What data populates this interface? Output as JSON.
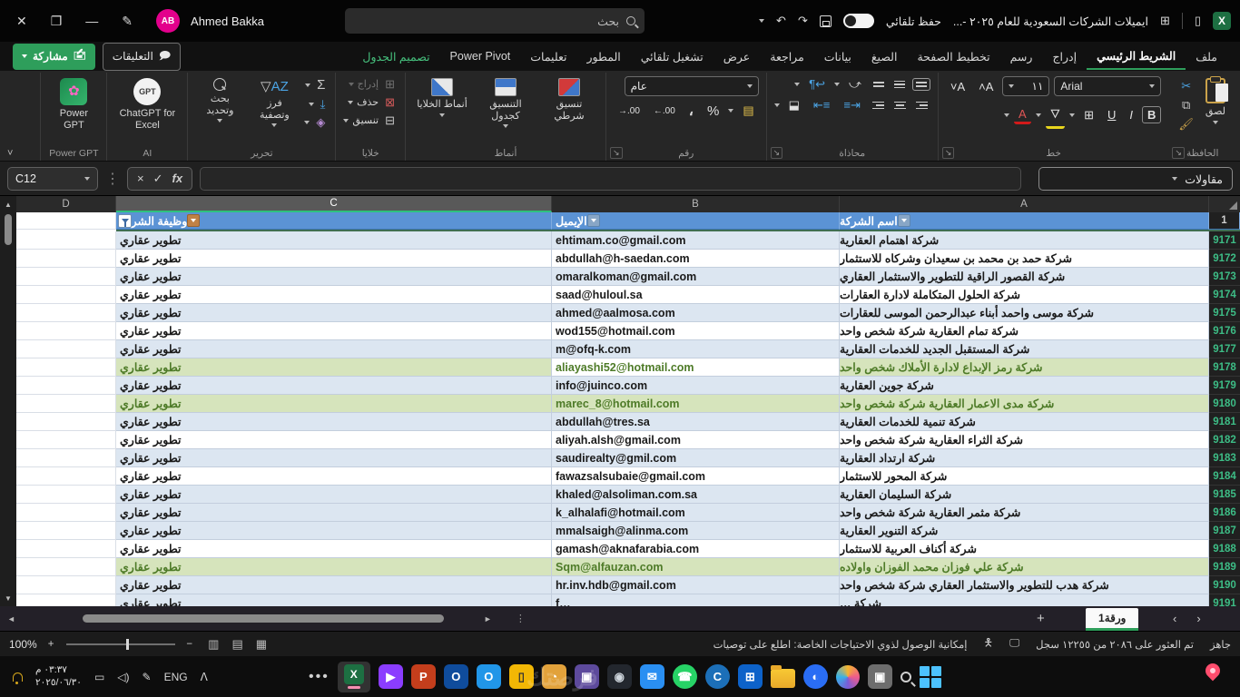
{
  "colors": {
    "excel_green": "#1d6f42",
    "accent_green": "#2e9e5b",
    "band_blue": "#dce6f1",
    "band_green": "#d6e4bc",
    "header_blue": "#5b93d5",
    "avatar_pink": "#e3008c"
  },
  "titlebar": {
    "user_initials": "AB",
    "user_name": "Ahmed Bakka",
    "search_placeholder": "بحث",
    "file_name": "ايميلات الشركات السعودية للعام ٢٠٢٥ -...",
    "autosave_label": "حفظ تلقائي"
  },
  "ribbon_tabs": {
    "items": [
      {
        "label": "ملف"
      },
      {
        "label": "الشريط الرئيسي",
        "active": true
      },
      {
        "label": "إدراج"
      },
      {
        "label": "رسم"
      },
      {
        "label": "تخطيط الصفحة"
      },
      {
        "label": "الصيغ"
      },
      {
        "label": "بيانات"
      },
      {
        "label": "مراجعة"
      },
      {
        "label": "عرض"
      },
      {
        "label": "تشغيل تلقائي"
      },
      {
        "label": "المطور"
      },
      {
        "label": "تعليمات"
      },
      {
        "label": "Power Pivot"
      },
      {
        "label": "تصميم الجدول",
        "accent": true
      }
    ],
    "comments_label": "التعليقات",
    "share_label": "مشاركة"
  },
  "ribbon": {
    "clipboard": {
      "label": "الحافظة",
      "paste": "لصق"
    },
    "font": {
      "label": "خط",
      "font_name": "Arial",
      "font_size": "١١",
      "bold": "B",
      "italic": "I",
      "underline": "U"
    },
    "alignment": {
      "label": "محاذاة"
    },
    "number": {
      "label": "رقم",
      "format": "عام",
      "percent": "%",
      "comma": "،"
    },
    "styles": {
      "label": "أنماط",
      "conditional": "تنسيق شرطي",
      "format_table": "التنسيق كجدول",
      "cell_styles": "أنماط الخلايا"
    },
    "cells": {
      "label": "خلايا",
      "insert": "إدراج",
      "delete": "حذف",
      "format": "تنسيق"
    },
    "editing": {
      "label": "تحرير",
      "autosum": "Σ",
      "sort_filter": "فرز وتصفية",
      "find_select": "بحث وتحديد"
    },
    "ai": {
      "label": "AI",
      "chatgpt": "ChatGPT for Excel",
      "icon_text": "GPT"
    },
    "powergpt": {
      "label": "Power GPT",
      "button": "Power GPT"
    }
  },
  "formula_bar": {
    "name_box": "C12",
    "fx": "fx",
    "cancel": "×",
    "enter": "✓",
    "value": "",
    "range_dropdown": "مقاولات"
  },
  "grid": {
    "column_letters": [
      "D",
      "C",
      "B",
      "A"
    ],
    "header_row_number": "1",
    "headers": {
      "job": "وظيفة الشركة",
      "email": "الإيميل",
      "name": "اسم الشركة"
    },
    "rows": [
      {
        "n": "9171",
        "name": "شركة اهتمام العقارية",
        "email": "ehtimam.co@gmail.com",
        "job": "تطوير عقاري",
        "band": "blue"
      },
      {
        "n": "9172",
        "name": "شركة حمد بن محمد بن سعيدان وشركاه للاستثمار",
        "email": "abdullah@h-saedan.com",
        "job": "تطوير عقاري",
        "band": "white"
      },
      {
        "n": "9173",
        "name": "شركة القصور الراقية للتطوير والاستثمار العقاري",
        "email": "omaralkoman@gmail.com",
        "job": "تطوير عقاري",
        "band": "blue"
      },
      {
        "n": "9174",
        "name": "شركة الحلول المتكاملة لادارة العقارات",
        "email": "saad@huloul.sa",
        "job": "تطوير عقاري",
        "band": "white"
      },
      {
        "n": "9175",
        "name": "شركة موسى واحمد أبناء عبدالرحمن الموسى للعقارات",
        "email": "ahmed@aalmosa.com",
        "job": "تطوير عقاري",
        "band": "blue"
      },
      {
        "n": "9176",
        "name": "شركة تمام العقارية شركة شخص واحد",
        "email": "wod155@hotmail.com",
        "job": "تطوير عقاري",
        "band": "white"
      },
      {
        "n": "9177",
        "name": "شركة المستقبل الجديد للخدمات العقارية",
        "email": "m@ofq-k.com",
        "job": "تطوير عقاري",
        "band": "blue"
      },
      {
        "n": "9178",
        "name": "شركة رمز الإبداع لادارة الأملاك شخص واحد",
        "email": "aliayashi52@hotmail.com",
        "job": "تطوير عقاري",
        "band": "green",
        "band_email": "white"
      },
      {
        "n": "9179",
        "name": "شركة جوين العقارية",
        "email": "info@juinco.com",
        "job": "تطوير عقاري",
        "band": "blue"
      },
      {
        "n": "9180",
        "name": "شركة مدى الاعمار العقارية شركة شخص واحد",
        "email": "marec_8@hotmail.com",
        "job": "تطوير عقاري",
        "band": "green"
      },
      {
        "n": "9181",
        "name": "شركة تنمية للخدمات العقارية",
        "email": "abdullah@tres.sa",
        "job": "تطوير عقاري",
        "band": "blue"
      },
      {
        "n": "9182",
        "name": "شركة الثراء العقارية شركة شخص واحد",
        "email": "aliyah.alsh@gmail.com",
        "job": "تطوير عقاري",
        "band": "white"
      },
      {
        "n": "9183",
        "name": "شركة ارتداد العقارية",
        "email": "saudirealty@gmil.com",
        "job": "تطوير عقاري",
        "band": "blue"
      },
      {
        "n": "9184",
        "name": "شركة المحور للاستثمار",
        "email": "fawazsalsubaie@gmail.com",
        "job": "تطوير عقاري",
        "band": "white"
      },
      {
        "n": "9185",
        "name": "شركة السليمان العقارية",
        "email": "khaled@alsoliman.com.sa",
        "job": "تطوير عقاري",
        "band": "blue"
      },
      {
        "n": "9186",
        "name": "شركة مثمر العقارية شركة شخص واحد",
        "email": "k_alhalafi@hotmail.com",
        "job": "تطوير عقاري",
        "band": "blue"
      },
      {
        "n": "9187",
        "name": "شركة التنوير العقارية",
        "email": "mmalsaigh@alinma.com",
        "job": "تطوير عقاري",
        "band": "blue"
      },
      {
        "n": "9188",
        "name": "شركة أكناف العربية للاستثمار",
        "email": "gamash@aknafarabia.com",
        "job": "تطوير عقاري",
        "band": "white"
      },
      {
        "n": "9189",
        "name": "شركة علي فوزان محمد الفوزان واولاده",
        "email": "Sqm@alfauzan.com",
        "job": "تطوير عقاري",
        "band": "green"
      },
      {
        "n": "9190",
        "name": "شركة هدب للتطوير والاستثمار العقاري شركة شخص واحد",
        "email": "hr.inv.hdb@gmail.com",
        "job": "تطوير عقاري",
        "band": "blue"
      }
    ],
    "partial_row": {
      "n": "9191",
      "name": "شركة …",
      "email": "f…",
      "job": "تطوير عقاري",
      "band": "blue"
    }
  },
  "sheet_tabs": {
    "active_tab": "ورقة1"
  },
  "status_bar": {
    "ready": "جاهز",
    "found_text": "تم العثور على ٢٠٨٦ من ١٢٢٥٥ سجل",
    "accessibility_text": "إمكانية الوصول لذوي الاحتياجات الخاصة: اطلع على توصيات",
    "zoom_level": "100%"
  },
  "taskbar": {
    "time": "٠٣:٣٧ م",
    "date": "٢٠٢٥/٠٦/٣٠",
    "language": "ENG",
    "overflow": "•••",
    "watermark": "فرصتك",
    "excel_label": "X",
    "apps": [
      {
        "name": "clipchamp-icon",
        "bg": "#8b3dff",
        "fg": "#ffffff",
        "glyph": "▶"
      },
      {
        "name": "powerpoint-icon",
        "bg": "#c43e1c",
        "fg": "#ffffff",
        "glyph": "P"
      },
      {
        "name": "outlook-classic-icon",
        "bg": "#0f4c9c",
        "fg": "#ffffff",
        "glyph": "O"
      },
      {
        "name": "outlook-new-icon",
        "bg": "#2196e8",
        "fg": "#ffffff",
        "glyph": "O"
      },
      {
        "name": "phone-link-icon",
        "bg": "#f2b705",
        "fg": "#333333",
        "glyph": "▯"
      },
      {
        "name": "clock-app-icon",
        "bg": "#e2a23b",
        "fg": "#ffffff",
        "glyph": "◔"
      },
      {
        "name": "vpn-app-icon",
        "bg": "#5d4a9c",
        "fg": "#ffffff",
        "glyph": "▣"
      },
      {
        "name": "github-desktop-icon",
        "bg": "#23272e",
        "fg": "#cfd6dd",
        "glyph": "◉"
      },
      {
        "name": "mail-icon",
        "bg": "#2a8ff2",
        "fg": "#ffffff",
        "glyph": "✉"
      },
      {
        "name": "whatsapp-icon",
        "bg": "#27d366",
        "fg": "#ffffff",
        "glyph": "☎",
        "round": true
      },
      {
        "name": "skype-icon",
        "bg": "#1c6fb8",
        "fg": "#ffffff",
        "glyph": "C",
        "round": true
      },
      {
        "name": "ms-store-icon",
        "bg": "#0d62c9",
        "fg": "#ffffff",
        "glyph": "⊞"
      },
      {
        "name": "file-explorer-icon",
        "type": "folder"
      },
      {
        "name": "edge-icon",
        "bg": "#2a6df4",
        "fg": "#ffffff",
        "glyph": "◐",
        "round": true
      },
      {
        "name": "copilot-icon",
        "type": "copilot"
      },
      {
        "name": "photos-icon",
        "bg": "#6d6d6d",
        "fg": "#ffffff",
        "glyph": "▣"
      },
      {
        "name": "search-icon",
        "type": "search"
      },
      {
        "name": "windows-start-icon",
        "type": "windows"
      }
    ]
  }
}
